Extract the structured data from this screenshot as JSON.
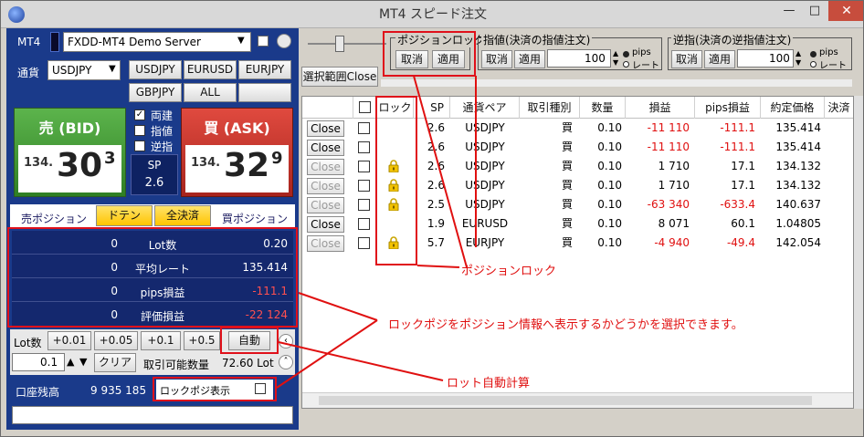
{
  "window": {
    "title": "MT4 スピード注文"
  },
  "top": {
    "mt4_label": "MT4",
    "server": "FXDD-MT4 Demo Server",
    "currency_label": "通貨",
    "currency_select": "USDJPY",
    "selection_close": "選択範囲Close"
  },
  "currency_buttons": [
    "USDJPY",
    "EURUSD",
    "EURJPY",
    "GBPJPY",
    "ALL"
  ],
  "bid": {
    "label": "売 (BID)",
    "prefix": "134.",
    "main": "30",
    "sup": "3"
  },
  "ask": {
    "label": "買 (ASK)",
    "prefix": "134.",
    "main": "32",
    "sup": "9"
  },
  "options": {
    "both": "両建",
    "limit": "指値",
    "stop": "逆指"
  },
  "spread": {
    "label": "SP",
    "value": "2.6"
  },
  "positions": {
    "sell_label": "売ポジション",
    "doten": "ドテン",
    "close_all": "全決済",
    "buy_label": "買ポジション"
  },
  "info": [
    {
      "left": "0",
      "label": "Lot数",
      "value": "0.20"
    },
    {
      "left": "0",
      "label": "平均レート",
      "value": "135.414"
    },
    {
      "left": "0",
      "label": "pips損益",
      "value": "-111.1"
    },
    {
      "left": "0",
      "label": "評価損益",
      "value": "-22 124"
    }
  ],
  "lot": {
    "label": "Lot数",
    "increments": [
      "+0.01",
      "+0.05",
      "+0.1",
      "+0.5"
    ],
    "auto": "自動",
    "value": "0.1",
    "clear": "クリア",
    "tradable_label": "取引可能数量",
    "tradable_value": "72.60 Lot"
  },
  "account": {
    "balance_label": "口座残高",
    "balance_value": "9 935 185",
    "lockpos_label": "ロックポジ表示"
  },
  "position_lock": {
    "title": "ポジションロック",
    "cancel": "取消",
    "apply": "適用"
  },
  "limit_order": {
    "title": "指値(決済の指値注文)",
    "cancel": "取消",
    "apply": "適用",
    "value": "100",
    "pips": "pips",
    "rate": "レート"
  },
  "stop_order": {
    "title": "逆指(決済の逆指値注文)",
    "cancel": "取消",
    "apply": "適用",
    "value": "100",
    "pips": "pips",
    "rate": "レート"
  },
  "table": {
    "headers": [
      "",
      "",
      "ロック",
      "SP",
      "通貨ペア",
      "取引種別",
      "数量",
      "損益",
      "pips損益",
      "約定価格",
      "決済"
    ],
    "rows": [
      {
        "close": "Close",
        "sp": "2.6",
        "pair": "USDJPY",
        "side": "買",
        "qty": "0.10",
        "pl": "-11 110",
        "pips": "-111.1",
        "price": "135.414",
        "locked": false,
        "enabled": true
      },
      {
        "close": "Close",
        "sp": "2.6",
        "pair": "USDJPY",
        "side": "買",
        "qty": "0.10",
        "pl": "-11 110",
        "pips": "-111.1",
        "price": "135.414",
        "locked": false,
        "enabled": true
      },
      {
        "close": "Close",
        "sp": "2.6",
        "pair": "USDJPY",
        "side": "買",
        "qty": "0.10",
        "pl": "1 710",
        "pips": "17.1",
        "price": "134.132",
        "locked": true,
        "enabled": false
      },
      {
        "close": "Close",
        "sp": "2.6",
        "pair": "USDJPY",
        "side": "買",
        "qty": "0.10",
        "pl": "1 710",
        "pips": "17.1",
        "price": "134.132",
        "locked": true,
        "enabled": false
      },
      {
        "close": "Close",
        "sp": "2.5",
        "pair": "USDJPY",
        "side": "買",
        "qty": "0.10",
        "pl": "-63 340",
        "pips": "-633.4",
        "price": "140.637",
        "locked": true,
        "enabled": false
      },
      {
        "close": "Close",
        "sp": "1.9",
        "pair": "EURUSD",
        "side": "買",
        "qty": "0.10",
        "pl": "8 071",
        "pips": "60.1",
        "price": "1.04805",
        "locked": false,
        "enabled": true
      },
      {
        "close": "Close",
        "sp": "5.7",
        "pair": "EURJPY",
        "side": "買",
        "qty": "0.10",
        "pl": "-4 940",
        "pips": "-49.4",
        "price": "142.054",
        "locked": true,
        "enabled": false
      }
    ]
  },
  "annotations": {
    "position_lock": "ポジションロック",
    "lockpos_display": "ロックポジをポジション情報へ表示するかどうかを選択できます。",
    "lot_auto": "ロット自動計算"
  },
  "colors": {
    "accent_red": "#e01010",
    "panel_blue": "#1a3a8a",
    "bid_green": "#3f9a30",
    "ask_red": "#c0302a",
    "doten_yellow": "#ffd21e"
  }
}
